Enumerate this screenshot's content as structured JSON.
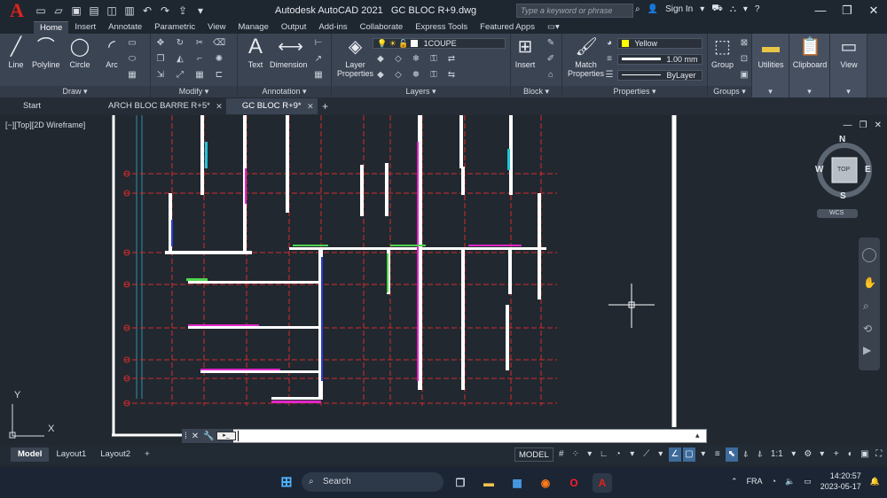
{
  "app": {
    "title": "Autodesk AutoCAD 2021",
    "filename": "GC BLOC R+9.dwg",
    "search_placeholder": "Type a keyword or phrase",
    "sign_in": "Sign In",
    "logo": "A"
  },
  "ribbon_tabs": [
    "Home",
    "Insert",
    "Annotate",
    "Parametric",
    "View",
    "Manage",
    "Output",
    "Add-ins",
    "Collaborate",
    "Express Tools",
    "Featured Apps"
  ],
  "draw": {
    "line": "Line",
    "polyline": "Polyline",
    "circle": "Circle",
    "arc": "Arc",
    "label": "Draw"
  },
  "modify": {
    "label": "Modify"
  },
  "annotation": {
    "text": "Text",
    "dimension": "Dimension",
    "label": "Annotation"
  },
  "layers": {
    "properties_line1": "Layer",
    "properties_line2": "Properties",
    "current_layer": "1COUPE",
    "label": "Layers"
  },
  "block": {
    "insert": "Insert",
    "label": "Block"
  },
  "properties": {
    "match_line1": "Match",
    "match_line2": "Properties",
    "color": "Yellow",
    "color_hex": "#ffff00",
    "lineweight": "1.00 mm",
    "linetype": "ByLayer",
    "label": "Properties"
  },
  "groups": {
    "group": "Group",
    "label": "Groups"
  },
  "utilities": {
    "label": "Utilities"
  },
  "clipboard": {
    "label": "Clipboard"
  },
  "view": {
    "label": "View"
  },
  "file_tabs": {
    "start": "Start",
    "tab1": "ARCH BLOC BARRE R+5*",
    "tab2": "GC BLOC R+9*"
  },
  "viewport": {
    "label": "[−][Top][2D Wireframe]",
    "cube_top": "TOP",
    "compass_n": "N",
    "compass_s": "S",
    "compass_e": "E",
    "compass_w": "W",
    "wcs": "WCS",
    "ucs_x": "X",
    "ucs_y": "Y"
  },
  "layout_tabs": [
    "Model",
    "Layout1",
    "Layout2"
  ],
  "status": {
    "model": "MODEL",
    "scale": "1:1"
  },
  "taskbar": {
    "search": "Search",
    "lang": "FRA",
    "time": "14:20:57",
    "date": "2023-05-17"
  },
  "colors": {
    "grid_red": "#d42c2c",
    "wall_white": "#ffffff",
    "accent_blue": "#3d6b9c"
  }
}
